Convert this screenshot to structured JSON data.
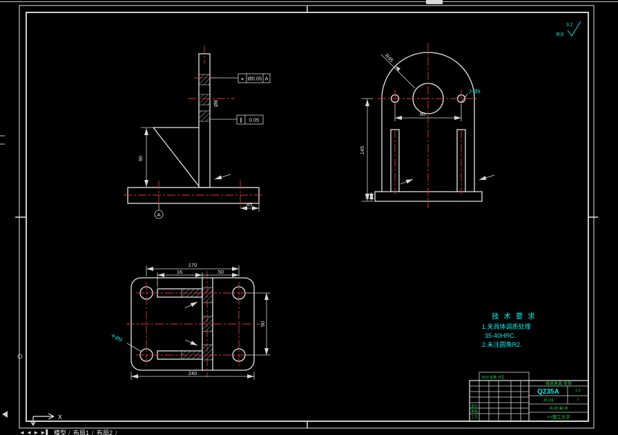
{
  "statusbar": {
    "nav": "◄ ◄ ► ►▌",
    "tab_model": "模型",
    "tab_layout1": "布局1",
    "tab_layout2": "布局2",
    "sep": "/"
  },
  "ucs": {
    "x_label": "X"
  },
  "roughness": {
    "rest": "其余",
    "value": "3.2"
  },
  "front_view": {
    "dim_height": "90",
    "dim_base_right": "45",
    "hole_label": "Ø8",
    "gdt_position": {
      "symbol": "⌖",
      "tolerance": "Ø0.05",
      "datum": "A"
    },
    "gdt_parallel": {
      "symbol": "∥",
      "tolerance": "0.05"
    },
    "datum_label": "A"
  },
  "side_view": {
    "dim_height": "145",
    "dim_hole_spacing": "80",
    "dim_base_thickness": "10",
    "radius_label": "R45",
    "holes_label": "2-Ø9"
  },
  "top_view": {
    "dim_hole_spacing_x": "170",
    "dim_slot": "16",
    "dim_offset": "50",
    "dim_width": "240",
    "dim_hole_spacing_y": "90",
    "holes_label": "4-Ø9"
  },
  "tech_req": {
    "title": "技 术 要 求",
    "line1": "1.夹具体调质处理",
    "line2": "35-40HRC.",
    "line3": "2.未注圆角R2."
  },
  "title_block": {
    "part_name": "铣床夹具-支架",
    "material": "Q235A",
    "drawing_no": "JX-04",
    "scale": "1:2",
    "qty": "1",
    "sheet": "共1张 第1张",
    "org": "××理工大学",
    "label_design": "设计",
    "label_check": "审核",
    "label_process": "工艺",
    "ext_note": "标记 处数 分区"
  }
}
